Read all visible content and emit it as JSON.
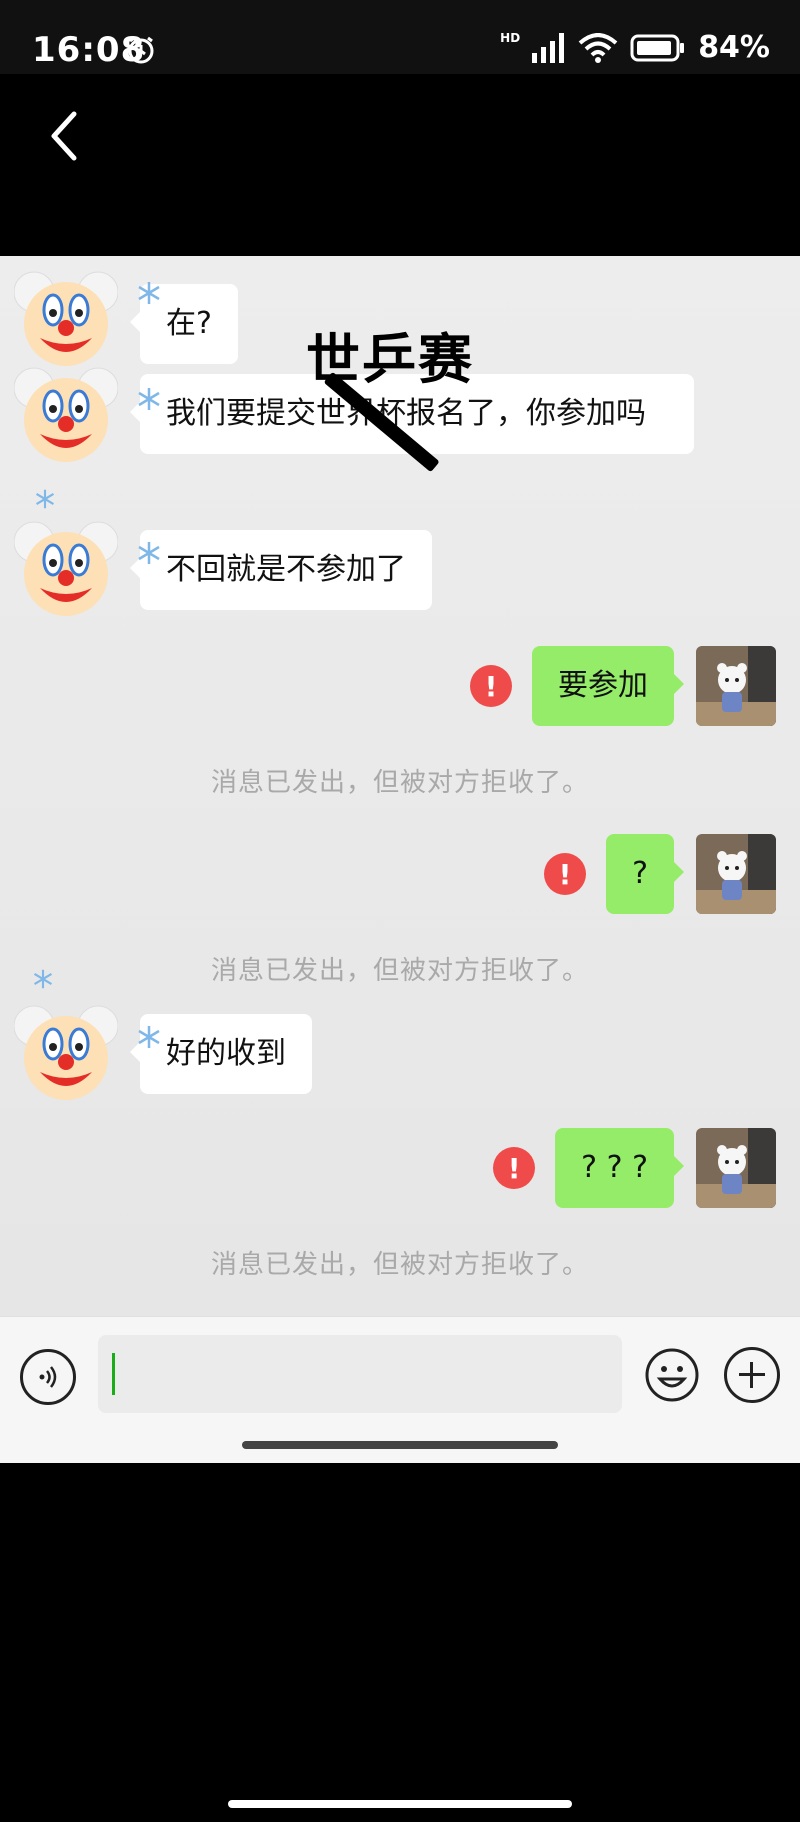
{
  "status_bar": {
    "time": "16:08",
    "network_label": "HD",
    "battery_percent": "84%"
  },
  "overlay": {
    "title": "世乒赛"
  },
  "messages": [
    {
      "side": "in",
      "text": "在?"
    },
    {
      "side": "in",
      "text": "我们要提交世界杯报名了，你参加吗"
    },
    {
      "side": "in",
      "text": "不回就是不参加了"
    },
    {
      "side": "out",
      "text": "要参加",
      "error": "!"
    },
    {
      "side": "out",
      "text": "?",
      "error": "!"
    },
    {
      "side": "in",
      "text": "好的收到"
    },
    {
      "side": "out",
      "text": "? ? ?",
      "error": "!"
    }
  ],
  "notices": [
    "消息已发出，但被对方拒收了。",
    "消息已发出，但被对方拒收了。",
    "消息已发出，但被对方拒收了。"
  ],
  "icons": {
    "back": "back-arrow-icon",
    "voice": "voice-icon",
    "emoji": "emoji-icon",
    "plus": "plus-icon",
    "alarm": "alarm-icon",
    "signal": "signal-icon",
    "wifi": "wifi-icon",
    "battery": "battery-icon"
  },
  "colors": {
    "out_bubble": "#95ec69",
    "in_bubble": "#ffffff",
    "error": "#f04b4b",
    "caret": "#1aad19"
  }
}
